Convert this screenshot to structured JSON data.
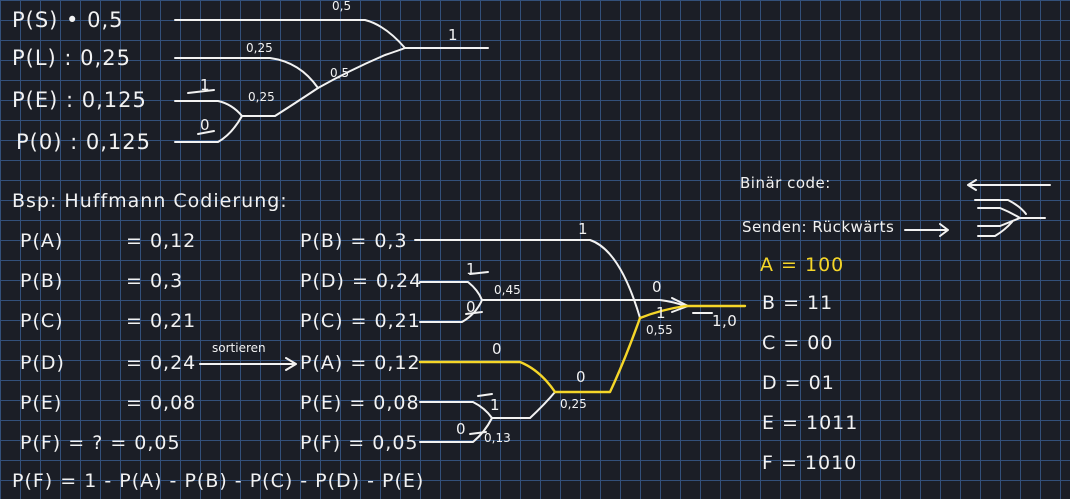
{
  "top": {
    "probs": [
      "P(S) • 0,5",
      "P(L) : 0,25",
      "P(E) : 0,125",
      "P(0) : 0,125"
    ],
    "tree_labels": {
      "s_top": "0,5",
      "l_top": "0,25",
      "merge_el": "0,25",
      "merge_mid": "0,5",
      "root": "1",
      "bit_e": "1",
      "bit_o": "0"
    }
  },
  "example": {
    "title": "Bsp: Huffmann Codierung:",
    "left": [
      "P(A)",
      "P(B)",
      "P(C)",
      "P(D)",
      "P(E)",
      "P(F) = ? = 0,05"
    ],
    "left_values": [
      "= 0,12",
      "= 0,3",
      "= 0,21",
      "= 0,24",
      "= 0,08"
    ],
    "sort_label": "sortieren",
    "sorted": [
      "P(B) = 0,3",
      "P(D) = 0,24",
      "P(C) = 0,21",
      "P(A) = 0,12",
      "P(E) = 0,08",
      "P(F) = 0,05"
    ],
    "formula": "P(F) = 1 - P(A) - P(B) - P(C) - P(D) - P(E)",
    "tree_labels": {
      "b_bit": "1",
      "d_bit": "1",
      "c_bit": "0",
      "dc_sum": "0,45",
      "dc_bit": "0",
      "root_left_bit": "1",
      "bigsum": "0,55",
      "root": "1,0",
      "a_bit": "0",
      "aef_bit": "0",
      "aef_sum": "0,25",
      "e_bit": "1",
      "f_bit": "0",
      "ef_sum": "0,13"
    }
  },
  "binary": {
    "title": "Binär code:",
    "send_label": "Senden: Rückwärts",
    "codes": [
      "A = 100",
      "B = 11",
      "C = 00",
      "D = 01",
      "E = 1011",
      "F = 1010"
    ]
  },
  "colors": {
    "background": "#1b1e26",
    "grid": "#33507a",
    "ink": "#f2f2f2",
    "highlight": "#f5d629"
  }
}
